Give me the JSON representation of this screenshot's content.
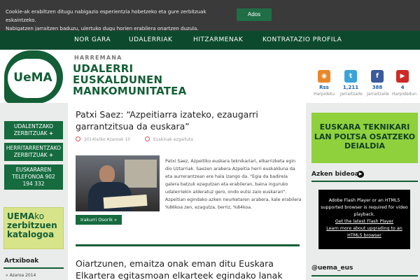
{
  "cookie": {
    "text_line1": "Cookie-ak erabiltzen ditugu nabigazio esperientzia hobetzeko eta gure zerbitzuak eskaintzeko.",
    "text_line2": "Nabigatzen jarraitzen baduzu, ulertuko dugu horien erabilera onartzen duzula.",
    "button_label": "Ados"
  },
  "nav": {
    "items": [
      "NOR GARA",
      "UDALERRIAK",
      "HITZARMENAK",
      "KONTRATAZIO PROFILA"
    ]
  },
  "header": {
    "logo_text": "UeMA",
    "tagline": "HARREMANA",
    "title_line1": "UDALERRI",
    "title_line2": "EUSKALDUNEN",
    "title_line3": "MANKOMUNITATEA"
  },
  "social": [
    {
      "icon": "rss-icon",
      "glyph": "Rss",
      "count": "Rss",
      "label": "Harpidetu",
      "color": "#e8882a"
    },
    {
      "icon": "twitter-icon",
      "glyph": "t",
      "count": "1,211",
      "label": "Jarraitzaile",
      "color": "#3aa4d8"
    },
    {
      "icon": "facebook-icon",
      "glyph": "f",
      "count": "388",
      "label": "Jarraitzaile",
      "color": "#3b5a9a"
    },
    {
      "icon": "youtube-icon",
      "glyph": "▶",
      "count": "4",
      "label": "Harpidedun",
      "color": "#cc2a26"
    }
  ],
  "sidebar": {
    "buttons": [
      {
        "line1": "UDALENTZAKO",
        "line2": "ZERBITZUAK",
        "plus": "+"
      },
      {
        "line1": "HERRITARRENTZAKO",
        "line2": "ZERBITZUAK",
        "plus": "+"
      },
      {
        "line1": "EUSKARAREN",
        "line2": "TELEFONOA 902",
        "line3": "194 332"
      }
    ],
    "katalogoa": {
      "word1": "UEMA",
      "word1b": "ko",
      "word2": "zerbitzuen",
      "word3": "katalogoa"
    },
    "archive_title": "Artxiboak",
    "archive_item": "» Azaroa 2014"
  },
  "article": {
    "title": "Patxi Saez: “Azpeitiarra izateko, ezaugarri garrantzitsua da euskara”",
    "date": "2014(e)ko Azaroak 10",
    "category": "Euskinak ezgaituta",
    "excerpt": "Patxi Saez, Azpeitiko euskara teknikariari, elkarrizketa egin dio Uztarriak. Saezen arabera Azpeitia herri euskalduna da eta aurrerantzean ere hala izango da. \"Egia da badirela galera batzuk ezagutzan eta erabileran, baina inguruko udalerriekin alderatuz gero, ondo eutsi zaio euskarari\". Azpeitian egindako azken neurketaren arabera, kale erabilera %86koa zen, ezagutza, berriz, %84koa.",
    "read_more": "Irakurri Osorik »"
  },
  "article2": {
    "title": "Oiartzunen, emaitza onak eman ditu Euskara Elkartera egitasmoan elkarteek egindako lanak"
  },
  "right": {
    "banner_line1": "EUSKARA TEKNIKARI",
    "banner_line2": "LAN POLTSA OSATZEKO",
    "banner_line3": "DEIALDIA",
    "video_title": "Azken bideoa",
    "flash_text": "Adobe Flash Player or an HTML5 supported browser is required for video playback.",
    "flash_link1": "Get the latest Flash Player",
    "flash_link2": "Learn more about upgrading to an HTML5 browser",
    "twitter_title": "@uema_eus"
  },
  "colors": {
    "brand_green": "#135e36",
    "nav_green": "#0d4a2d",
    "banner_green": "#8fd03d"
  }
}
